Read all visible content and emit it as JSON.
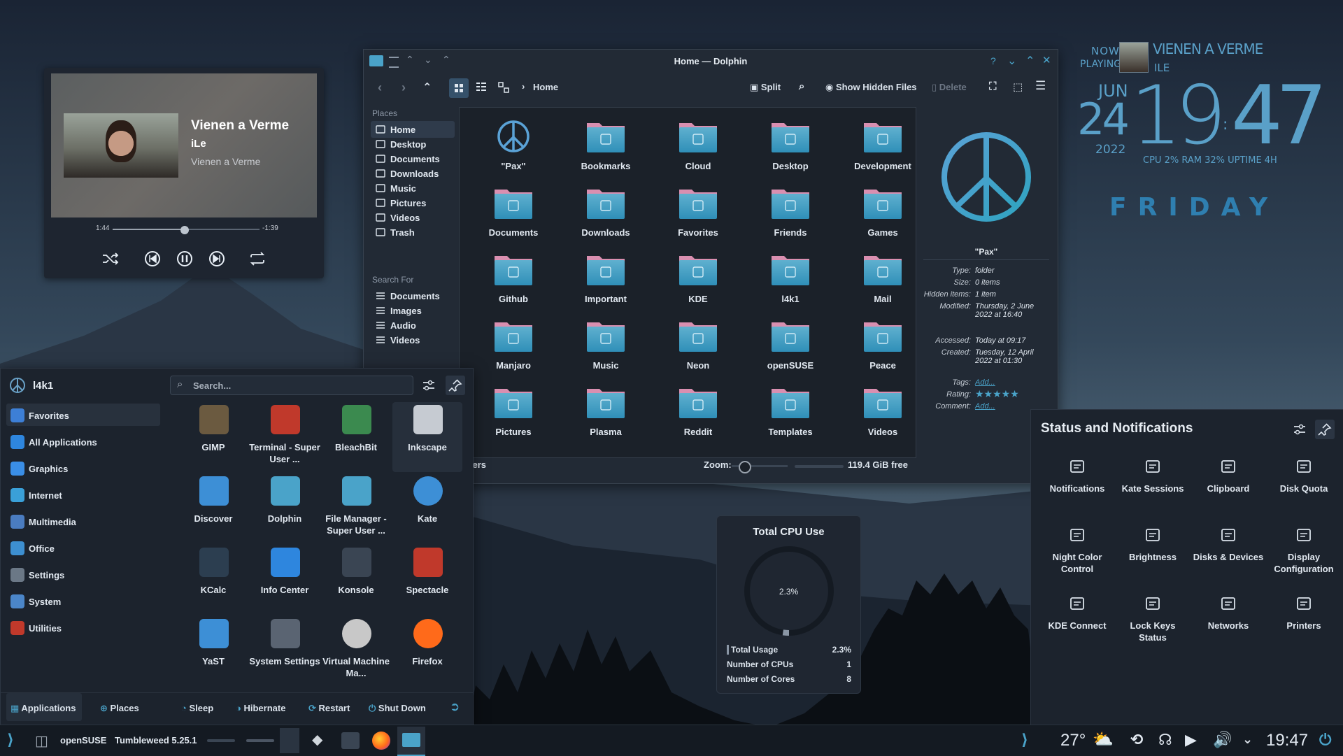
{
  "media_player": {
    "song": "Vienen a Verme",
    "artist": "iLe",
    "album": "Vienen a Verme",
    "elapsed": "1:44",
    "remaining": "-1:39",
    "progress": 0.49,
    "controls": [
      "shuffle-icon",
      "previous-icon",
      "pause-icon",
      "next-icon",
      "repeat-icon"
    ]
  },
  "dolphin": {
    "title": "Home — Dolphin",
    "breadcrumb": "Home",
    "toolbar": {
      "split": "Split",
      "show_hidden": "Show Hidden Files",
      "delete": "Delete"
    },
    "places_header": "Places",
    "places": [
      {
        "label": "Home",
        "icon": "home-icon",
        "selected": true
      },
      {
        "label": "Desktop",
        "icon": "desktop-icon"
      },
      {
        "label": "Documents",
        "icon": "documents-icon"
      },
      {
        "label": "Downloads",
        "icon": "downloads-icon"
      },
      {
        "label": "Music",
        "icon": "music-icon"
      },
      {
        "label": "Pictures",
        "icon": "pictures-icon"
      },
      {
        "label": "Videos",
        "icon": "videos-icon"
      },
      {
        "label": "Trash",
        "icon": "trash-icon"
      }
    ],
    "search_header": "Search For",
    "search_for": [
      {
        "label": "Documents",
        "icon": "documents-icon"
      },
      {
        "label": "Images",
        "icon": "images-icon"
      },
      {
        "label": "Audio",
        "icon": "audio-icon"
      },
      {
        "label": "Videos",
        "icon": "videos-icon"
      }
    ],
    "files": [
      "\"Pax\"",
      "Bookmarks",
      "Cloud",
      "Desktop",
      "Development",
      "Documents",
      "Downloads",
      "Favorites",
      "Friends",
      "Games",
      "Github",
      "Important",
      "KDE",
      "l4k1",
      "Mail",
      "Manjaro",
      "Music",
      "Neon",
      "openSUSE",
      "Peace",
      "Pictures",
      "Plasma",
      "Reddit",
      "Templates",
      "Videos"
    ],
    "info_panel": {
      "name": "\"Pax\"",
      "rows": [
        {
          "k": "Type:",
          "v": "folder"
        },
        {
          "k": "Size:",
          "v": "0 items"
        },
        {
          "k": "Hidden items:",
          "v": "1 item"
        },
        {
          "k": "Modified:",
          "v": "Thursday, 2 June 2022 at 16:40"
        },
        {
          "k": "Accessed:",
          "v": "Today at 09:17"
        },
        {
          "k": "Created:",
          "v": "Tuesday, 12 April 2022 at 01:30"
        },
        {
          "k": "Tags:",
          "v": "Add..."
        },
        {
          "k": "Rating:",
          "v": ""
        },
        {
          "k": "Comment:",
          "v": "Add..."
        }
      ],
      "rating": 5
    },
    "status": {
      "left": "olders",
      "zoom_label": "Zoom:",
      "free": "119.4 GiB free"
    }
  },
  "launcher": {
    "user": "l4k1",
    "search_placeholder": "Search...",
    "categories": [
      {
        "label": "Favorites",
        "color": "#3d7fd6"
      },
      {
        "label": "All Applications",
        "color": "#2e86de"
      },
      {
        "label": "Graphics",
        "color": "#3a8ee6"
      },
      {
        "label": "Internet",
        "color": "#3aa0d8"
      },
      {
        "label": "Multimedia",
        "color": "#4a7cc0"
      },
      {
        "label": "Office",
        "color": "#3d8fd0"
      },
      {
        "label": "Settings",
        "color": "#6b7886"
      },
      {
        "label": "System",
        "color": "#4b86c9"
      },
      {
        "label": "Utilities",
        "color": "#c0392b"
      }
    ],
    "apps": [
      {
        "label": "GIMP",
        "icon": "gimp-icon"
      },
      {
        "label": "Terminal - Super User ...",
        "icon": "terminal-icon"
      },
      {
        "label": "BleachBit",
        "icon": "bleachbit-icon"
      },
      {
        "label": "Inkscape",
        "icon": "inkscape-icon"
      },
      {
        "label": "Discover",
        "icon": "discover-icon"
      },
      {
        "label": "Dolphin",
        "icon": "dolphin-icon"
      },
      {
        "label": "File Manager - Super User ...",
        "icon": "file-manager-icon"
      },
      {
        "label": "Kate",
        "icon": "kate-icon"
      },
      {
        "label": "KCalc",
        "icon": "kcalc-icon"
      },
      {
        "label": "Info Center",
        "icon": "info-center-icon"
      },
      {
        "label": "Konsole",
        "icon": "konsole-icon"
      },
      {
        "label": "Spectacle",
        "icon": "spectacle-icon"
      },
      {
        "label": "YaST",
        "icon": "yast-icon"
      },
      {
        "label": "System Settings",
        "icon": "system-settings-icon"
      },
      {
        "label": "Virtual Machine Ma...",
        "icon": "virt-manager-icon"
      },
      {
        "label": "Firefox",
        "icon": "firefox-icon"
      }
    ],
    "footer": {
      "applications": "Applications",
      "places": "Places",
      "sleep": "Sleep",
      "hibernate": "Hibernate",
      "restart": "Restart",
      "shutdown": "Shut Down"
    }
  },
  "clock_widget": {
    "now": "NOW",
    "playing": "PLAYING",
    "song": "VIENEN A VERME",
    "artist": "ILE",
    "month": "JUN",
    "day": "24",
    "year": "2022",
    "hour": "19",
    "minute": "47",
    "stats": "CPU 2%  RAM 32%  UPTIME 4H",
    "weekday": "FRIDAY"
  },
  "cpu_widget": {
    "title": "Total CPU Use",
    "center": "2.3%",
    "usage_fraction": 0.023,
    "rows": [
      {
        "k": "Total Usage",
        "v": "2.3%"
      },
      {
        "k": "Number of CPUs",
        "v": "1"
      },
      {
        "k": "Number of Cores",
        "v": "8"
      }
    ]
  },
  "status_panel": {
    "title": "Status and Notifications",
    "items": [
      {
        "label": "Notifications",
        "icon": "notifications-icon"
      },
      {
        "label": "Kate Sessions",
        "icon": "kate-sessions-icon"
      },
      {
        "label": "Clipboard",
        "icon": "clipboard-icon"
      },
      {
        "label": "Disk Quota",
        "icon": "disk-quota-icon"
      },
      {
        "label": "Night Color Control",
        "icon": "night-color-icon"
      },
      {
        "label": "Brightness",
        "icon": "brightness-icon"
      },
      {
        "label": "Disks & Devices",
        "icon": "disks-devices-icon"
      },
      {
        "label": "Display Configuration",
        "icon": "display-configuration-icon"
      },
      {
        "label": "KDE Connect",
        "icon": "kde-connect-icon"
      },
      {
        "label": "Lock Keys Status",
        "icon": "lock-keys-icon"
      },
      {
        "label": "Networks",
        "icon": "networks-icon"
      },
      {
        "label": "Printers",
        "icon": "printers-icon"
      }
    ]
  },
  "taskbar": {
    "os": "openSUSE",
    "version": "Tumbleweed 5.25.1",
    "temperature": "27°",
    "time": "19:47"
  }
}
